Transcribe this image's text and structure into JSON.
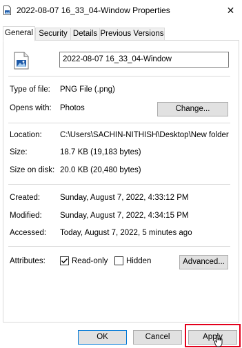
{
  "window": {
    "title": "2022-08-07 16_33_04-Window Properties",
    "close_glyph": "✕"
  },
  "tabs": [
    {
      "label": "General",
      "active": true
    },
    {
      "label": "Security",
      "active": false
    },
    {
      "label": "Details",
      "active": false
    },
    {
      "label": "Previous Versions",
      "active": false
    }
  ],
  "general": {
    "file_name": "2022-08-07 16_33_04-Window",
    "type_label": "Type of file:",
    "type_value": "PNG File (.png)",
    "opens_label": "Opens with:",
    "opens_value": "Photos",
    "change_button": "Change...",
    "location_label": "Location:",
    "location_value": "C:\\Users\\SACHIN-NITHISH\\Desktop\\New folder",
    "size_label": "Size:",
    "size_value": "18.7 KB (19,183 bytes)",
    "size_disk_label": "Size on disk:",
    "size_disk_value": "20.0 KB (20,480 bytes)",
    "created_label": "Created:",
    "created_value": "Sunday, August 7, 2022, 4:33:12 PM",
    "modified_label": "Modified:",
    "modified_value": "Sunday, August 7, 2022, 4:34:15 PM",
    "accessed_label": "Accessed:",
    "accessed_value": "Today, August 7, 2022, 5 minutes ago",
    "attributes_label": "Attributes:",
    "readonly_label": "Read-only",
    "readonly_checked": true,
    "hidden_label": "Hidden",
    "hidden_checked": false,
    "advanced_button": "Advanced..."
  },
  "footer": {
    "ok_button": "OK",
    "cancel_button": "Cancel",
    "apply_button": "Apply"
  },
  "colors": {
    "highlight": "#e3001b",
    "accent": "#0078d7",
    "icon_blue": "#1e5aa8"
  }
}
